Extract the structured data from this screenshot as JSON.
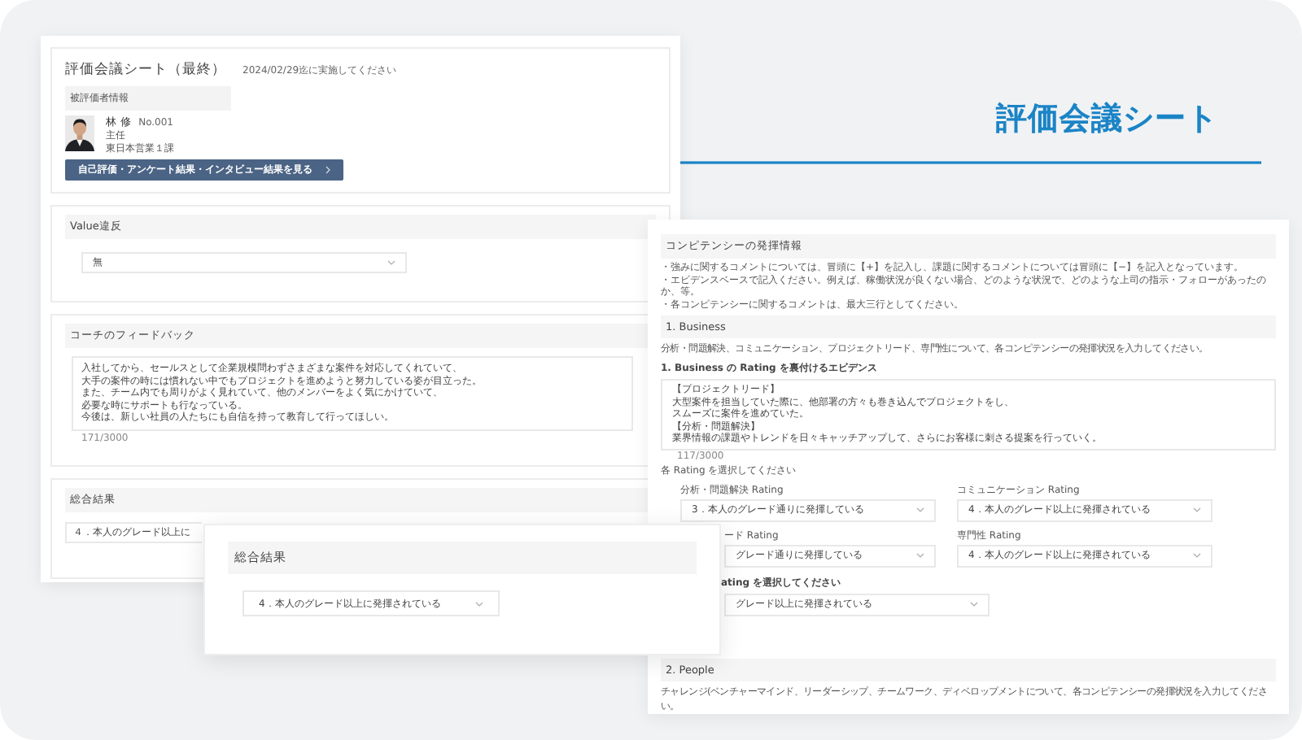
{
  "headline": "評価会議シート",
  "sheet": {
    "title": "評価会議シート（最終）",
    "deadline": "2024/02/29迄に実施してください",
    "profile": {
      "heading": "被評価者情報",
      "name": "林 修",
      "number": "No.001",
      "position": "主任",
      "department": "東日本営業１課"
    },
    "action_button": "自己評価・アンケート結果・インタビュー結果を見る",
    "value_violation": {
      "heading": "Value違反",
      "select": "無"
    },
    "feedback": {
      "heading": "コーチのフィードバック",
      "lines": [
        "入社してから、セールスとして企業規模問わずさまざまな案件を対応してくれていて、",
        "大手の案件の時には慣れない中でもプロジェクトを進めようと努力している姿が目立った。",
        "また、チーム内でも周りがよく見れていて、他のメンバーをよく気にかけていて、",
        "必要な時にサポートも行なっている。",
        "今後は、新しい社員の人たちにも自信を持って教育して行ってほしい。"
      ],
      "counter": "171/3000"
    },
    "overall": {
      "heading": "総合結果",
      "select": "４．本人のグレード以上に"
    }
  },
  "competency": {
    "heading": "コンピテンシーの発揮情報",
    "notes": [
      "・強みに関するコメントについては、冒頭に【+】を記入し、課題に関するコメントについては冒頭に【−】を記入となっています。",
      "・エビデンスベースで記入ください。例えば、稼働状況が良くない場合、どのような状況で、どのような上司の指示・フォローがあったのか、等。",
      "・各コンピテンシーに関するコメントは、最大三行としてください。"
    ],
    "business": {
      "title": "1. Business",
      "description": "分析・問題解決、コミュニケーション、プロジェクトリード、専門性について、各コンピテンシーの発揮状況を入力してください。",
      "evidence_label": "1. Business の Rating を裏付けるエビデンス",
      "evidence_lines": [
        "【プロジェクトリード】",
        "大型案件を担当していた際に、他部署の方々も巻き込んでプロジェクトをし、",
        "スムーズに案件を進めていた。",
        "【分析・問題解決】",
        "業界情報の課題やトレンドを日々キャッチアップして、さらにお客様に刺さる提案を行っていく。"
      ],
      "counter": "117/3000",
      "rating_prompt": "各 Rating を選択してください",
      "ratings": [
        {
          "label": "分析・問題解決 Rating",
          "value": "3．本人のグレード通りに発揮している"
        },
        {
          "label": "コミュニケーション Rating",
          "value": "4．本人のグレード以上に発揮されている"
        },
        {
          "label": "ード Rating",
          "value": "グレード通りに発揮している"
        },
        {
          "label": "専門性 Rating",
          "value": "4．本人のグレード以上に発揮されている"
        }
      ],
      "overall_label": "ating を選択してください",
      "overall_value": "グレード以上に発揮されている"
    },
    "people": {
      "title": "2. People",
      "description": "チャレンジ(ベンチャーマインド、リーダーシップ、チームワーク、ディベロップメントについて、各コンピテンシーの発揮状況を入力してください。"
    }
  },
  "overall_popup": {
    "heading": "総合結果",
    "select": "4．本人のグレード以上に発揮されている"
  }
}
